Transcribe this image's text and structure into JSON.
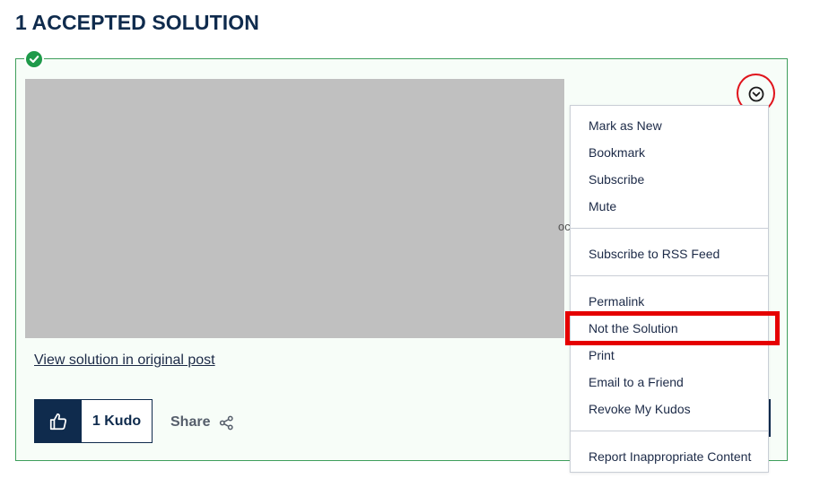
{
  "heading": "1 ACCEPTED SOLUTION",
  "post": {
    "peek_text": "oc",
    "view_link": "View solution in original post"
  },
  "kudos": {
    "count_label": "1 Kudo",
    "thumb_icon": "thumbs-up-icon"
  },
  "share": {
    "label": "Share",
    "icon": "share-icon"
  },
  "options_menu": {
    "toggle_icon": "chevron-down-circle-icon",
    "groups": [
      [
        "Mark as New",
        "Bookmark",
        "Subscribe",
        "Mute"
      ],
      [
        "Subscribe to RSS Feed"
      ],
      [
        "Permalink",
        "Not the Solution",
        "Print",
        "Email to a Friend",
        "Revoke My Kudos"
      ],
      [
        "Report Inappropriate Content"
      ]
    ],
    "highlighted_item": "Not the Solution"
  },
  "colors": {
    "accent_navy": "#0f2b4d",
    "accepted_green": "#1f9a4a",
    "annotation_red": "#e50000"
  }
}
